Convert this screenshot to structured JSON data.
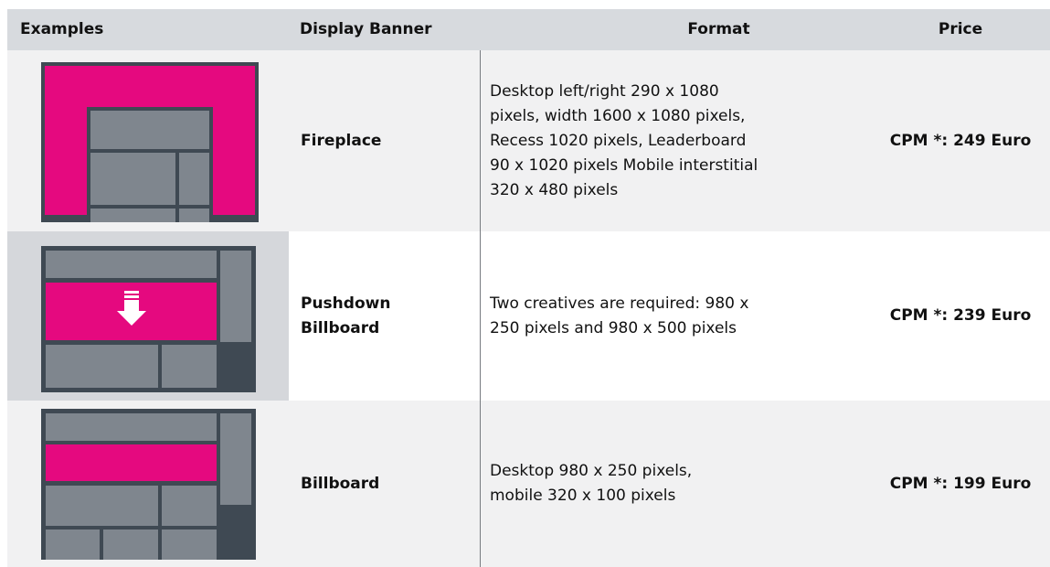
{
  "headers": {
    "examples": "Examples",
    "display_banner": "Display Banner",
    "format": "Format",
    "price": "Price"
  },
  "rows": [
    {
      "banner": "Fireplace",
      "format_lines": [
        "Desktop left/right 290 x 1080",
        "pixels, width 1600 x 1080 pixels,",
        "Recess 1020 pixels, Leaderboard",
        "90 x 1020 pixels Mobile interstitial",
        "320 x 480 pixels"
      ],
      "price": "CPM *: 249 Euro",
      "icon": "fireplace-banner-icon"
    },
    {
      "banner_lines": [
        "Pushdown",
        "Billboard"
      ],
      "format_lines": [
        "Two creatives are required: 980 x",
        "250 pixels and 980 x 500 pixels"
      ],
      "price": "CPM *: 239 Euro",
      "icon": "pushdown-billboard-icon"
    },
    {
      "banner": "Billboard",
      "format_lines": [
        "Desktop 980 x 250 pixels,",
        "mobile 320 x 100 pixels"
      ],
      "price": "CPM *: 199 Euro",
      "icon": "billboard-icon"
    }
  ],
  "colors": {
    "accent_magenta": "#e5097f",
    "block_gray": "#7f868e",
    "frame_dark": "#3f4953",
    "header_bg": "#d7dade"
  }
}
